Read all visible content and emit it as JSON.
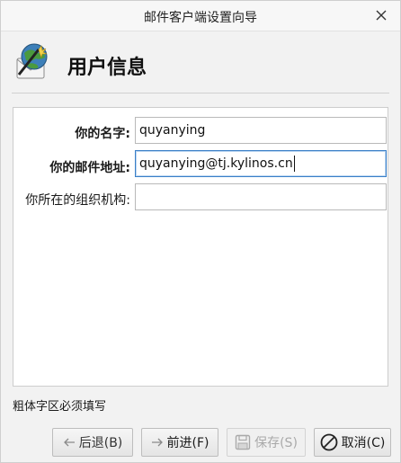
{
  "window": {
    "title": "邮件客户端设置向导"
  },
  "header": {
    "title": "用户信息",
    "icon": "mail-wizard-icon"
  },
  "form": {
    "name_label": "你的名字:",
    "name_value": "quyanying",
    "email_label": "你的邮件地址:",
    "email_value": "quyanying@tj.kylinos.cn",
    "org_label": "你所在的组织机构:",
    "org_value": ""
  },
  "note": "粗体字区必须填写",
  "buttons": {
    "back_label": "后退(B)",
    "next_label": "前进(F)",
    "save_label": "保存(S)",
    "cancel_label": "取消(C)"
  },
  "colors": {
    "focus_border": "#3a7fc7",
    "window_bg": "#f2f2f2"
  }
}
